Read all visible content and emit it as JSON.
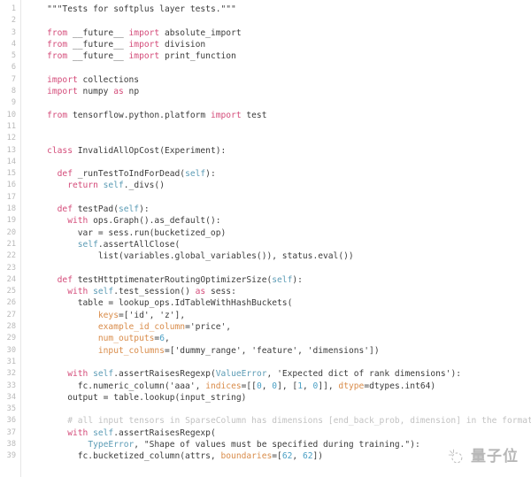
{
  "editor": {
    "language": "python",
    "theme": "light",
    "gutter_visible": true,
    "first_line_number": 1,
    "last_line_number": 39,
    "colors": {
      "background": "#ffffff",
      "gutter_text": "#b9b9b9",
      "gutter_rule": "#e6e6e6",
      "default_text": "#3b3b3b",
      "keyword": "#d44c7a",
      "self_builtin": "#5b9bb5",
      "keyword_argument": "#d98c4a",
      "number": "#4a9fc4",
      "exception": "#5b9bb5",
      "comment": "#c2c2c2"
    }
  },
  "lines": [
    {
      "n": "1",
      "tokens": [
        {
          "t": "    ",
          "c": "plain"
        },
        {
          "t": "\"\"\"Tests for softplus layer tests.\"\"\"",
          "c": "doc"
        }
      ]
    },
    {
      "n": "2",
      "tokens": []
    },
    {
      "n": "3",
      "tokens": [
        {
          "t": "    ",
          "c": "plain"
        },
        {
          "t": "from",
          "c": "kw"
        },
        {
          "t": " __future__ ",
          "c": "plain"
        },
        {
          "t": "import",
          "c": "kw"
        },
        {
          "t": " absolute_import",
          "c": "plain"
        }
      ]
    },
    {
      "n": "4",
      "tokens": [
        {
          "t": "    ",
          "c": "plain"
        },
        {
          "t": "from",
          "c": "kw"
        },
        {
          "t": " __future__ ",
          "c": "plain"
        },
        {
          "t": "import",
          "c": "kw"
        },
        {
          "t": " division",
          "c": "plain"
        }
      ]
    },
    {
      "n": "5",
      "tokens": [
        {
          "t": "    ",
          "c": "plain"
        },
        {
          "t": "from",
          "c": "kw"
        },
        {
          "t": " __future__ ",
          "c": "plain"
        },
        {
          "t": "import",
          "c": "kw"
        },
        {
          "t": " print_function",
          "c": "plain"
        }
      ]
    },
    {
      "n": "6",
      "tokens": []
    },
    {
      "n": "7",
      "tokens": [
        {
          "t": "    ",
          "c": "plain"
        },
        {
          "t": "import",
          "c": "kw"
        },
        {
          "t": " collections",
          "c": "plain"
        }
      ]
    },
    {
      "n": "8",
      "tokens": [
        {
          "t": "    ",
          "c": "plain"
        },
        {
          "t": "import",
          "c": "kw"
        },
        {
          "t": " numpy ",
          "c": "plain"
        },
        {
          "t": "as",
          "c": "kw"
        },
        {
          "t": " np",
          "c": "plain"
        }
      ]
    },
    {
      "n": "9",
      "tokens": []
    },
    {
      "n": "10",
      "tokens": [
        {
          "t": "    ",
          "c": "plain"
        },
        {
          "t": "from",
          "c": "kw"
        },
        {
          "t": " tensorflow.python.platform ",
          "c": "plain"
        },
        {
          "t": "import",
          "c": "kw"
        },
        {
          "t": " test",
          "c": "plain"
        }
      ]
    },
    {
      "n": "11",
      "tokens": []
    },
    {
      "n": "12",
      "tokens": []
    },
    {
      "n": "13",
      "tokens": [
        {
          "t": "    ",
          "c": "plain"
        },
        {
          "t": "class",
          "c": "kw"
        },
        {
          "t": " InvalidAllOpCost(Experiment):",
          "c": "plain"
        }
      ]
    },
    {
      "n": "14",
      "tokens": []
    },
    {
      "n": "15",
      "tokens": [
        {
          "t": "      ",
          "c": "plain"
        },
        {
          "t": "def",
          "c": "kw"
        },
        {
          "t": " _runTestToIndForDead(",
          "c": "plain"
        },
        {
          "t": "self",
          "c": "self"
        },
        {
          "t": "):",
          "c": "plain"
        }
      ]
    },
    {
      "n": "16",
      "tokens": [
        {
          "t": "        ",
          "c": "plain"
        },
        {
          "t": "return",
          "c": "kw"
        },
        {
          "t": " ",
          "c": "plain"
        },
        {
          "t": "self",
          "c": "self"
        },
        {
          "t": "._divs()",
          "c": "plain"
        }
      ]
    },
    {
      "n": "17",
      "tokens": []
    },
    {
      "n": "18",
      "tokens": [
        {
          "t": "      ",
          "c": "plain"
        },
        {
          "t": "def",
          "c": "kw"
        },
        {
          "t": " testPad(",
          "c": "plain"
        },
        {
          "t": "self",
          "c": "self"
        },
        {
          "t": "):",
          "c": "plain"
        }
      ]
    },
    {
      "n": "19",
      "tokens": [
        {
          "t": "        ",
          "c": "plain"
        },
        {
          "t": "with",
          "c": "kw"
        },
        {
          "t": " ops.Graph().as_default():",
          "c": "plain"
        }
      ]
    },
    {
      "n": "20",
      "tokens": [
        {
          "t": "          var = sess.run(bucketized_op)",
          "c": "plain"
        }
      ]
    },
    {
      "n": "21",
      "tokens": [
        {
          "t": "          ",
          "c": "plain"
        },
        {
          "t": "self",
          "c": "self"
        },
        {
          "t": ".assertAllClose(",
          "c": "plain"
        }
      ]
    },
    {
      "n": "22",
      "tokens": [
        {
          "t": "              list(variables.global_variables()), status.eval())",
          "c": "plain"
        }
      ]
    },
    {
      "n": "23",
      "tokens": []
    },
    {
      "n": "24",
      "tokens": [
        {
          "t": "      ",
          "c": "plain"
        },
        {
          "t": "def",
          "c": "kw"
        },
        {
          "t": " testHttptimenaterRoutingOptimizerSize(",
          "c": "plain"
        },
        {
          "t": "self",
          "c": "self"
        },
        {
          "t": "):",
          "c": "plain"
        }
      ]
    },
    {
      "n": "25",
      "tokens": [
        {
          "t": "        ",
          "c": "plain"
        },
        {
          "t": "with",
          "c": "kw"
        },
        {
          "t": " ",
          "c": "plain"
        },
        {
          "t": "self",
          "c": "self"
        },
        {
          "t": ".test_session() ",
          "c": "plain"
        },
        {
          "t": "as",
          "c": "kw"
        },
        {
          "t": " sess:",
          "c": "plain"
        }
      ]
    },
    {
      "n": "26",
      "tokens": [
        {
          "t": "          table = lookup_ops.IdTableWithHashBuckets(",
          "c": "plain"
        }
      ]
    },
    {
      "n": "27",
      "tokens": [
        {
          "t": "              ",
          "c": "plain"
        },
        {
          "t": "keys",
          "c": "kwarg"
        },
        {
          "t": "=[",
          "c": "plain"
        },
        {
          "t": "'id'",
          "c": "str"
        },
        {
          "t": ", ",
          "c": "plain"
        },
        {
          "t": "'z'",
          "c": "str"
        },
        {
          "t": "],",
          "c": "plain"
        }
      ]
    },
    {
      "n": "28",
      "tokens": [
        {
          "t": "              ",
          "c": "plain"
        },
        {
          "t": "example_id_column",
          "c": "kwarg"
        },
        {
          "t": "=",
          "c": "plain"
        },
        {
          "t": "'price'",
          "c": "str"
        },
        {
          "t": ",",
          "c": "plain"
        }
      ]
    },
    {
      "n": "29",
      "tokens": [
        {
          "t": "              ",
          "c": "plain"
        },
        {
          "t": "num_outputs",
          "c": "kwarg"
        },
        {
          "t": "=",
          "c": "plain"
        },
        {
          "t": "6",
          "c": "num"
        },
        {
          "t": ",",
          "c": "plain"
        }
      ]
    },
    {
      "n": "30",
      "tokens": [
        {
          "t": "              ",
          "c": "plain"
        },
        {
          "t": "input_columns",
          "c": "kwarg"
        },
        {
          "t": "=[",
          "c": "plain"
        },
        {
          "t": "'dummy_range'",
          "c": "str"
        },
        {
          "t": ", ",
          "c": "plain"
        },
        {
          "t": "'feature'",
          "c": "str"
        },
        {
          "t": ", ",
          "c": "plain"
        },
        {
          "t": "'dimensions'",
          "c": "str"
        },
        {
          "t": "])",
          "c": "plain"
        }
      ]
    },
    {
      "n": "31",
      "tokens": []
    },
    {
      "n": "32",
      "tokens": [
        {
          "t": "        ",
          "c": "plain"
        },
        {
          "t": "with",
          "c": "kw"
        },
        {
          "t": " ",
          "c": "plain"
        },
        {
          "t": "self",
          "c": "self"
        },
        {
          "t": ".assertRaisesRegexp(",
          "c": "plain"
        },
        {
          "t": "ValueError",
          "c": "exc"
        },
        {
          "t": ", ",
          "c": "plain"
        },
        {
          "t": "'Expected dict of rank dimensions'",
          "c": "str"
        },
        {
          "t": "):",
          "c": "plain"
        }
      ]
    },
    {
      "n": "33",
      "tokens": [
        {
          "t": "          fc.numeric_column(",
          "c": "plain"
        },
        {
          "t": "'aaa'",
          "c": "str"
        },
        {
          "t": ", ",
          "c": "plain"
        },
        {
          "t": "indices",
          "c": "kwarg"
        },
        {
          "t": "=[[",
          "c": "plain"
        },
        {
          "t": "0",
          "c": "num"
        },
        {
          "t": ", ",
          "c": "plain"
        },
        {
          "t": "0",
          "c": "num"
        },
        {
          "t": "], [",
          "c": "plain"
        },
        {
          "t": "1",
          "c": "num"
        },
        {
          "t": ", ",
          "c": "plain"
        },
        {
          "t": "0",
          "c": "num"
        },
        {
          "t": "]], ",
          "c": "plain"
        },
        {
          "t": "dtype",
          "c": "kwarg"
        },
        {
          "t": "=dtypes.int64)",
          "c": "plain"
        }
      ]
    },
    {
      "n": "34",
      "tokens": [
        {
          "t": "        output = table.lookup(input_string)",
          "c": "plain"
        }
      ]
    },
    {
      "n": "35",
      "tokens": []
    },
    {
      "n": "36",
      "tokens": [
        {
          "t": "        ",
          "c": "plain"
        },
        {
          "t": "# all input tensors in SparseColumn has dimensions [end_back_prob, dimension] in the format.",
          "c": "com"
        }
      ]
    },
    {
      "n": "37",
      "tokens": [
        {
          "t": "        ",
          "c": "plain"
        },
        {
          "t": "with",
          "c": "kw"
        },
        {
          "t": " ",
          "c": "plain"
        },
        {
          "t": "self",
          "c": "self"
        },
        {
          "t": ".assertRaisesRegexp(",
          "c": "plain"
        }
      ]
    },
    {
      "n": "38",
      "tokens": [
        {
          "t": "            ",
          "c": "plain"
        },
        {
          "t": "TypeError",
          "c": "exc"
        },
        {
          "t": ", ",
          "c": "plain"
        },
        {
          "t": "\"Shape of values must be specified during training.\"",
          "c": "str"
        },
        {
          "t": "):",
          "c": "plain"
        }
      ]
    },
    {
      "n": "39",
      "tokens": [
        {
          "t": "          fc.bucketized_column(attrs, ",
          "c": "plain"
        },
        {
          "t": "boundaries",
          "c": "kwarg"
        },
        {
          "t": "=[",
          "c": "plain"
        },
        {
          "t": "62",
          "c": "num"
        },
        {
          "t": ", ",
          "c": "plain"
        },
        {
          "t": "62",
          "c": "num"
        },
        {
          "t": "])",
          "c": "plain"
        }
      ]
    }
  ],
  "watermark": {
    "text": "量子位",
    "icon": "sparkle-circle-icon"
  }
}
